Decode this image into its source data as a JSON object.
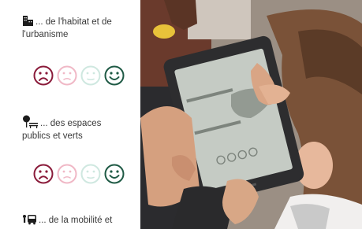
{
  "survey": {
    "questions": [
      {
        "icon": "building-icon",
        "text": "... de l'habitat et de l'urbanisme"
      },
      {
        "icon": "park-bench-icon",
        "text": "... des espaces publics et verts"
      },
      {
        "icon": "bus-icon",
        "text": "... de la mobilité et"
      }
    ],
    "faces": [
      "very-sad",
      "sad",
      "neutral",
      "happy"
    ],
    "colors": {
      "very_sad": "#8a1b3a",
      "sad": "#f0b8c6",
      "neutral": "#cfe8e0",
      "happy": "#1f5a45"
    }
  }
}
